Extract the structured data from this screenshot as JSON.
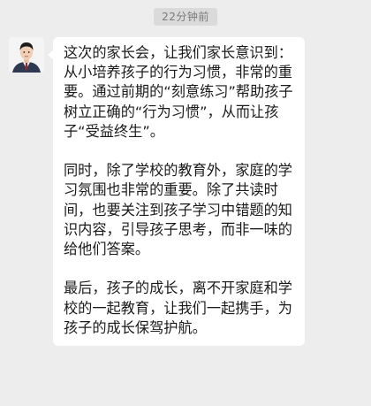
{
  "chat": {
    "timestamp": "22分钟前",
    "message": {
      "avatar_icon": "user-photo-avatar",
      "paragraphs": [
        "这次的家长会，让我们家长意识到：从小培养孩子的行为习惯，非常的重要。通过前期的“刻意练习”帮助孩子树立正确的“行为习惯”，从而让孩子“受益终生”。",
        "同时，除了学校的教育外，家庭的学习氛围也非常的重要。除了共读时间，也要关注到孩子学习中错题的知识内容，引导孩子思考，而非一味的给他们答案。",
        "最后，孩子的成长，离不开家庭和学校的一起教育，让我们一起携手，为孩子的成长保驾护航。"
      ]
    }
  }
}
